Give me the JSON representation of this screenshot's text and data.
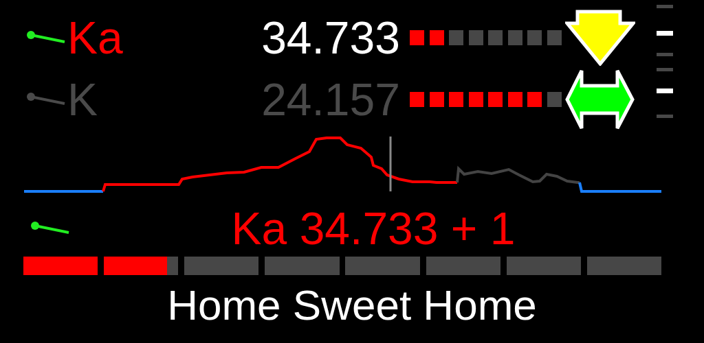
{
  "strings": [
    {
      "label": "Ka",
      "value": "34.733",
      "active": true,
      "level": 0.25,
      "kind": "down",
      "color": "#ffff00"
    },
    {
      "label": "K",
      "value": "24.157",
      "active": false,
      "level": 0.875,
      "kind": "both",
      "color": "#00ff00"
    }
  ],
  "current": {
    "note": "Ka 34.733 + 1",
    "level": 0.225
  },
  "title": "Home Sweet Home"
}
